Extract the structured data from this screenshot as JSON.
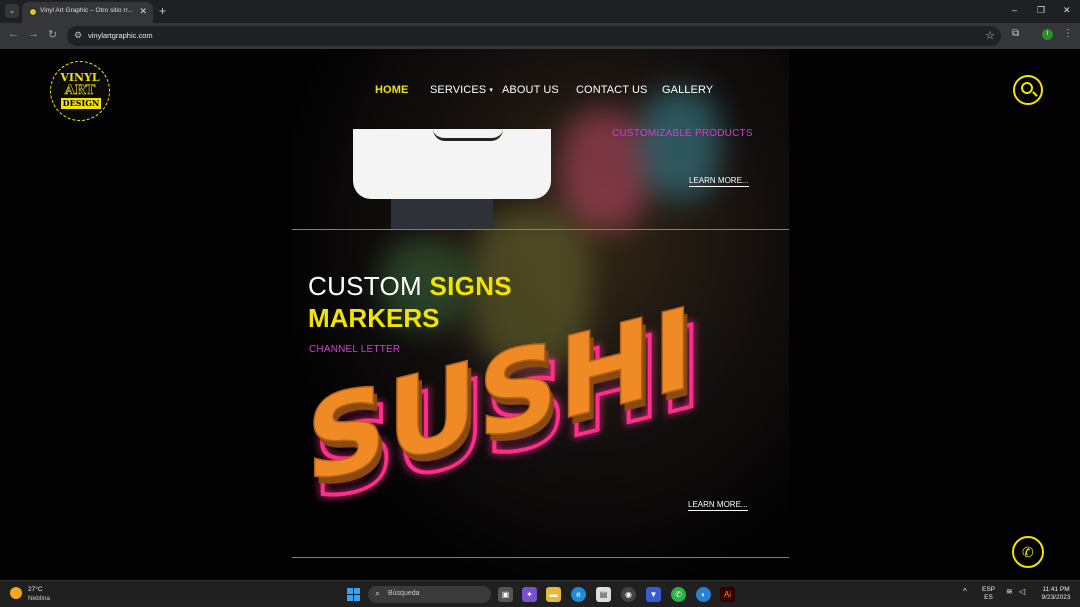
{
  "browser": {
    "tab_title": "Vinyl Art Graphic – Otro sitio rr...",
    "tab_close": "✕",
    "new_tab": "+",
    "url": "vinylartgraphic.com",
    "window_controls": [
      "–",
      "❐",
      "✕"
    ],
    "profile_initial": "I",
    "icons": [
      "tab-search-icon",
      "back-icon",
      "forward-icon",
      "reload-icon",
      "site-info-icon",
      "bookmark-star-icon",
      "extensions-icon",
      "menu-icon"
    ]
  },
  "site": {
    "logo": {
      "line1": "VINYL",
      "line2": "ART",
      "line3": "DESIGN"
    },
    "nav": [
      {
        "label": "HOME",
        "active": true
      },
      {
        "label": "SERVICES",
        "active": false,
        "caret": "▾"
      },
      {
        "label": "ABOUT US",
        "active": false
      },
      {
        "label": "CONTACT US",
        "active": false
      },
      {
        "label": "GALLERY",
        "active": false
      }
    ],
    "section1": {
      "subtitle": "CUSTOMIZABLE PRODUCTS",
      "learn_more": "LEARN MORE..."
    },
    "section2": {
      "title_plain": "CUSTOM ",
      "title_highlight": "SIGNS",
      "title_line2": "MARKERS",
      "subtitle": "CHANNEL LETTER",
      "image_text": "SUSHI",
      "learn_more": "LEARN MORE..."
    },
    "colors": {
      "accent": "#f2e400",
      "pink": "#d23fd0",
      "neon": "#ff2e8a",
      "letters": "#f08a24"
    }
  },
  "taskbar": {
    "weather_temp": "27°C",
    "weather_desc": "Neblina",
    "search_placeholder": "Búsqueda",
    "lang_top": "ESP",
    "lang_bottom": "ES",
    "time": "11:41 PM",
    "date": "9/23/2023"
  }
}
